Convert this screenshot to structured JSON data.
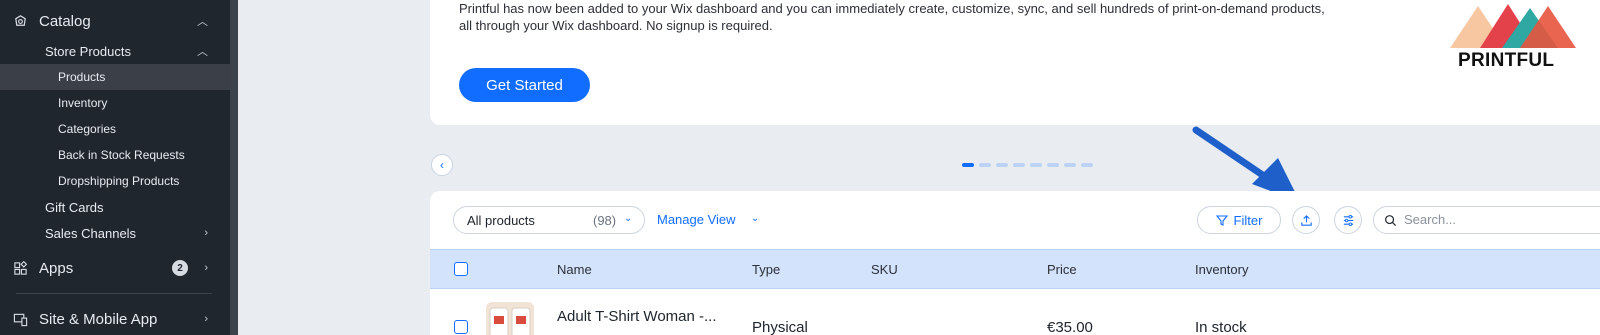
{
  "sidebar": {
    "catalog": "Catalog",
    "store_products": "Store Products",
    "items": [
      {
        "label": "Products"
      },
      {
        "label": "Inventory"
      },
      {
        "label": "Categories"
      },
      {
        "label": "Back in Stock Requests"
      },
      {
        "label": "Dropshipping Products"
      }
    ],
    "gift_cards": "Gift Cards",
    "sales_channels": "Sales Channels",
    "apps": "Apps",
    "apps_badge": "2",
    "site_mobile": "Site & Mobile App"
  },
  "banner": {
    "text": "Printful has now been added to your Wix dashboard and you can immediately create, customize, sync, and sell hundreds of print-on-demand products, all through your Wix dashboard. No signup is required.",
    "cta": "Get Started",
    "logo_text": "PRINTFUL"
  },
  "toolbar": {
    "view_label": "All products",
    "view_count": "(98)",
    "manage_view": "Manage View",
    "filter": "Filter",
    "search_placeholder": "Search..."
  },
  "table": {
    "columns": [
      "Name",
      "Type",
      "SKU",
      "Price",
      "Inventory"
    ],
    "rows": [
      {
        "name": "Adult T-Shirt Woman -...",
        "type": "Physical",
        "sku": "",
        "price": "€35.00",
        "inventory": "In stock"
      }
    ]
  },
  "colors": {
    "accent": "#116dff",
    "sidebar_bg": "#20262e",
    "header_bg": "#d3e3fc"
  }
}
